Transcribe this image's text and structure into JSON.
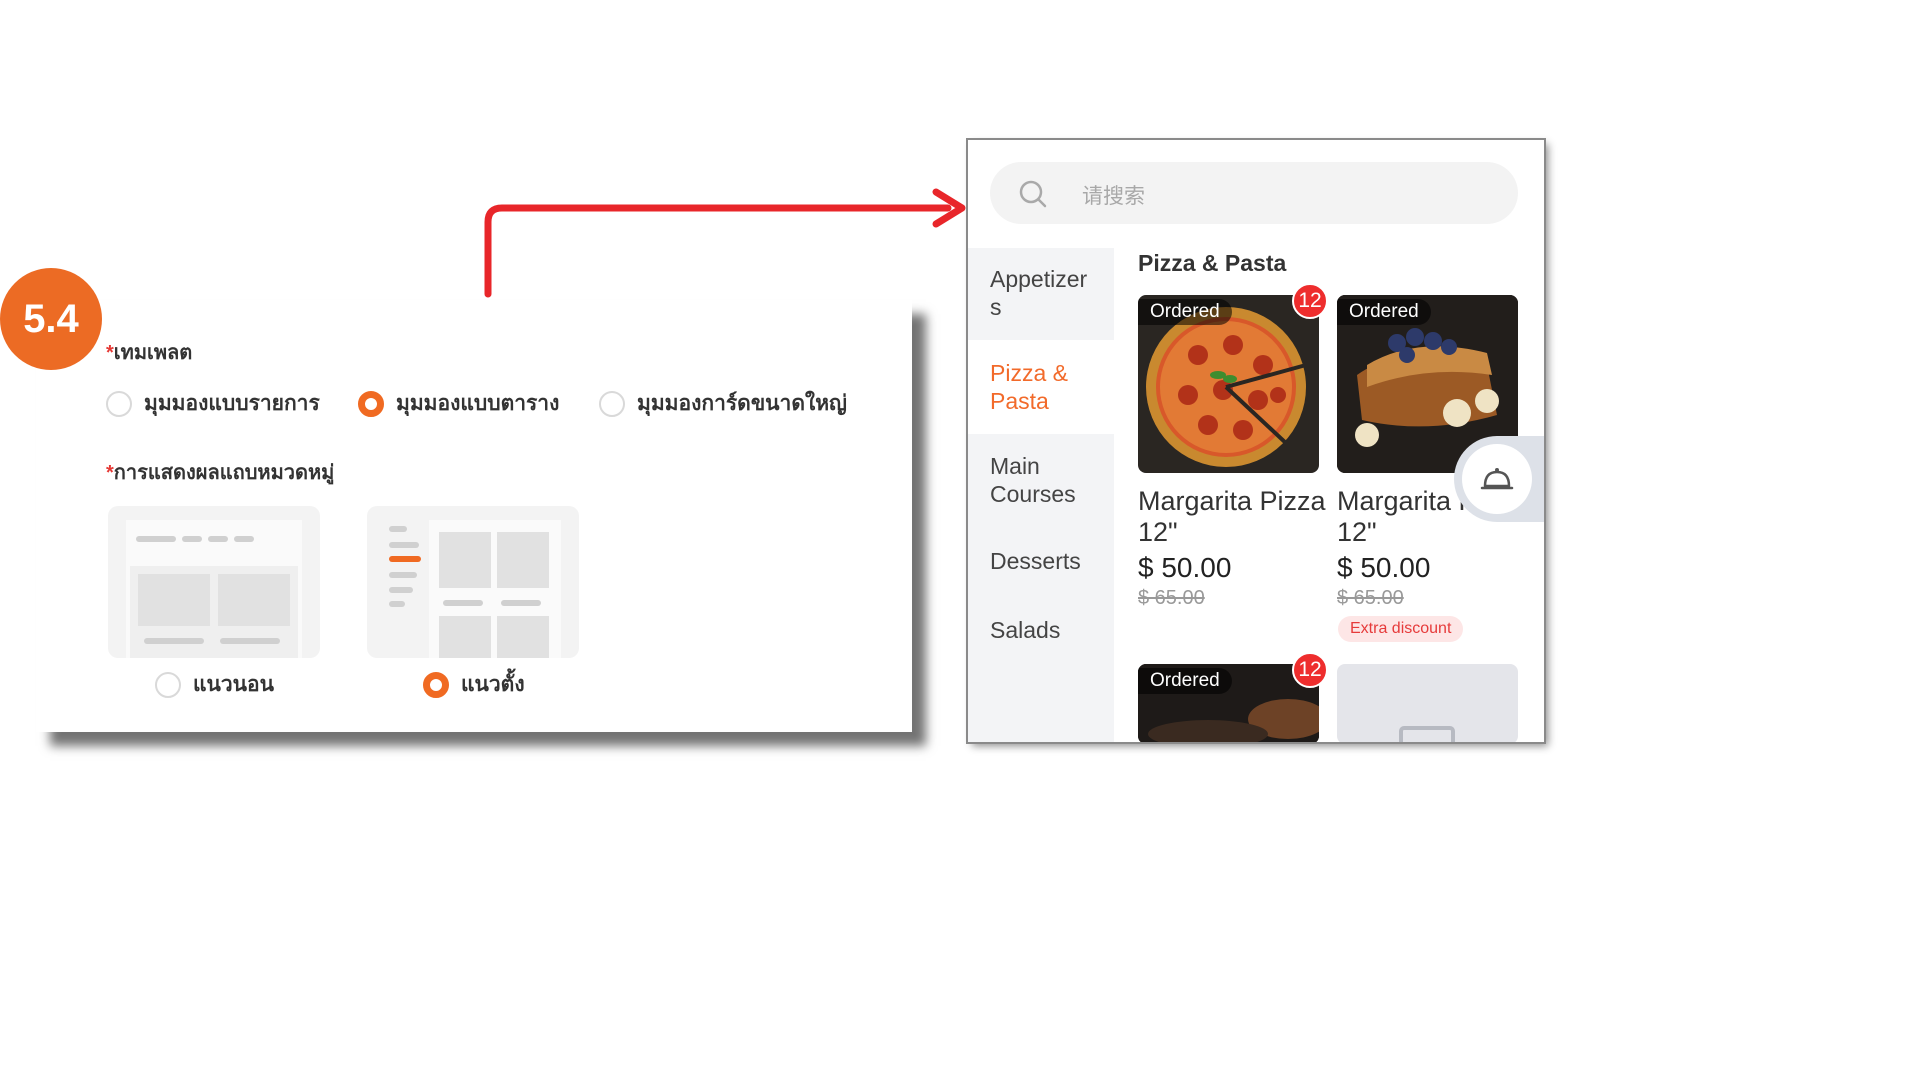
{
  "step": {
    "number": "5.4"
  },
  "settings": {
    "template": {
      "label": "เทมเพลต",
      "required_mark": "*",
      "options": [
        {
          "label": "มุมมองแบบรายการ",
          "checked": false
        },
        {
          "label": "มุมมองแบบตาราง",
          "checked": true
        },
        {
          "label": "มุมมองการ์ดขนาดใหญ่",
          "checked": false
        }
      ]
    },
    "category_bar": {
      "label": "การแสดงผลแถบหมวดหมู่",
      "required_mark": "*",
      "options": [
        {
          "label": "แนวนอน",
          "checked": false
        },
        {
          "label": "แนวตั้ง",
          "checked": true
        }
      ]
    }
  },
  "preview": {
    "search_placeholder": "请搜索",
    "categories": [
      {
        "label": "Appetizers",
        "active": false
      },
      {
        "label": "Pizza & Pasta",
        "active": true
      },
      {
        "label": "Main Courses",
        "active": false
      },
      {
        "label": "Desserts",
        "active": false
      },
      {
        "label": "Salads",
        "active": false
      }
    ],
    "section_title": "Pizza & Pasta",
    "products": [
      {
        "name": "Margarita Pizza 12\"",
        "price": "$ 50.00",
        "old_price": "$ 65.00",
        "ordered_label": "Ordered",
        "count": "12",
        "extra_tag": ""
      },
      {
        "name": "Margarita Pizza 12\"",
        "price": "$ 50.00",
        "old_price": "$ 65.00",
        "ordered_label": "Ordered",
        "count": "",
        "extra_tag": "Extra discount"
      },
      {
        "name": "",
        "price": "",
        "old_price": "",
        "ordered_label": "Ordered",
        "count": "12",
        "extra_tag": ""
      }
    ]
  },
  "colors": {
    "accent": "#f06a22",
    "badge_red": "#ee2d2d",
    "arrow_red": "#e8262a"
  }
}
